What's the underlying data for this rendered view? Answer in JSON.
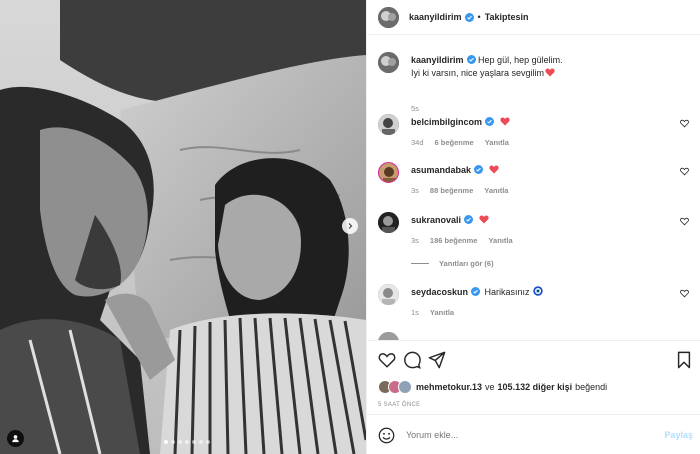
{
  "header": {
    "username": "kaanyildirim",
    "separator": "•",
    "follow_status": "Takiptesin"
  },
  "caption": {
    "username": "kaanyildirim",
    "line1": "Hep gül, hep gülelim.",
    "line2": "Iyi ki varsın, nice yaşlara sevgilim",
    "time": "5s"
  },
  "comments": [
    {
      "username": "belcimbilgincom",
      "text": "",
      "time": "34d",
      "likes": "6 beğenme",
      "reply": "Yanıtla"
    },
    {
      "username": "asumandabak",
      "text": "",
      "time": "3s",
      "likes": "88 beğenme",
      "reply": "Yanıtla"
    },
    {
      "username": "sukranovali",
      "text": "",
      "time": "3s",
      "likes": "186 beğenme",
      "reply": "Yanıtla"
    },
    {
      "username": "seydacoskun",
      "text": "Harikasınız",
      "time": "1s",
      "likes": "",
      "reply": "Yanıtla"
    }
  ],
  "view_replies": "Yanıtları gör (6)",
  "likes_summary": {
    "user": "mehmetokur.13",
    "conj": "ve",
    "count_text": "105.132 diğer kişi",
    "suffix": "beğendi"
  },
  "post_time": "5 SAAT ÖNCE",
  "add_comment": {
    "placeholder": "Yorum ekle...",
    "post_label": "Paylaş"
  },
  "icons": [
    "heart-icon",
    "comment-icon",
    "share-icon",
    "bookmark-icon",
    "emoji-icon",
    "chevron-right-icon",
    "user-tag-icon",
    "verified-icon"
  ],
  "colors": {
    "verified": "#3897f0",
    "heart_red": "#ed4956",
    "post_disabled": "#b2dffc",
    "meta_gray": "#8e8e8e"
  },
  "carousel": {
    "total": 7,
    "active": 1
  }
}
